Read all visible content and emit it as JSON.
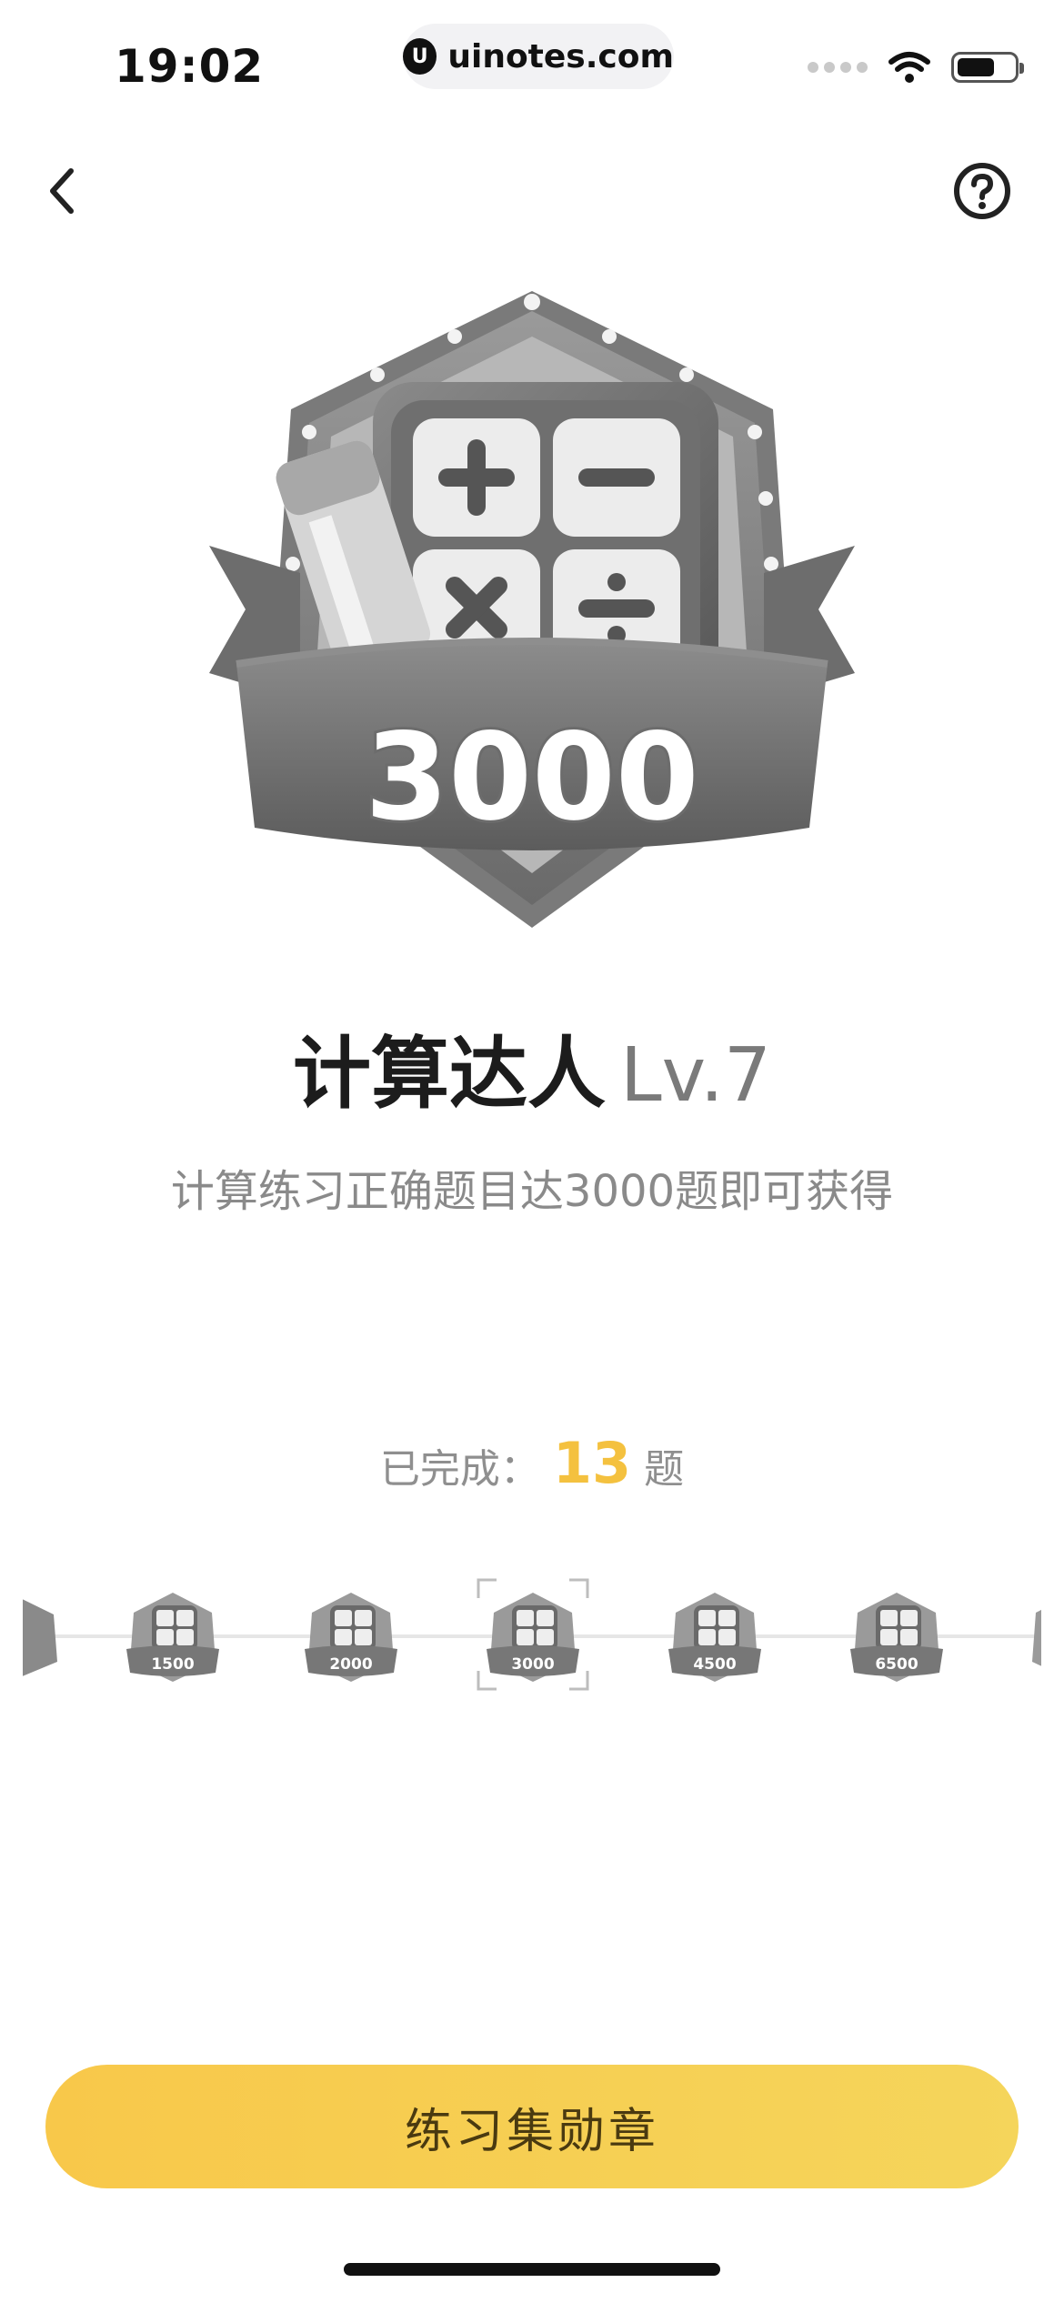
{
  "status_bar": {
    "time": "19:02",
    "url_logo": "U",
    "url": "uinotes.com",
    "icons": [
      "signal-dots",
      "wifi-icon",
      "battery-icon"
    ]
  },
  "nav": {
    "back_icon": "chevron-left-icon",
    "help_icon": "question-circle-icon"
  },
  "hero_badge": {
    "number": "3000",
    "symbols": [
      "+",
      "−",
      "×",
      "÷"
    ]
  },
  "title": {
    "main": "计算达人",
    "level": "Lv.7"
  },
  "subtitle": "计算练习正确题目达3000题即可获得",
  "progress": {
    "prefix": "已完成：",
    "count": "13",
    "suffix": "题"
  },
  "badge_strip": {
    "badges": [
      {
        "label": "1500"
      },
      {
        "label": "2000"
      },
      {
        "label": "3000",
        "selected": true
      },
      {
        "label": "4500"
      },
      {
        "label": "6500"
      }
    ]
  },
  "cta": {
    "label": "练习集勋章"
  },
  "colors": {
    "accent": "#F4C13F",
    "cta_start": "#F8C84A",
    "cta_end": "#F5D55B"
  }
}
